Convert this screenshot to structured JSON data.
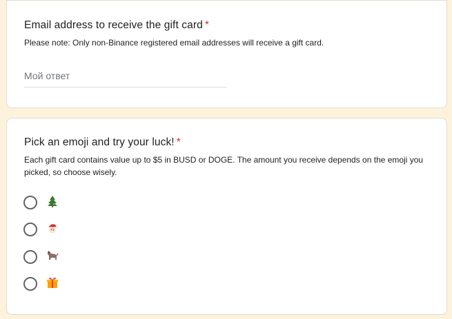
{
  "email_question": {
    "title": "Email address to receive the gift card",
    "required_mark": "*",
    "description": "Please note: Only non-Binance registered email addresses will receive a gift card.",
    "answer_placeholder": "Мой ответ"
  },
  "emoji_question": {
    "title": "Pick an emoji and try your luck!",
    "required_mark": "*",
    "description": "Each gift card contains value up to $5 in BUSD or DOGE. The amount you receive depends on the emoji you picked, so choose wisely.",
    "options": [
      {
        "icon": "christmas-tree-emoji",
        "selected": false
      },
      {
        "icon": "santa-claus-emoji",
        "selected": false
      },
      {
        "icon": "dog-emoji",
        "selected": false
      },
      {
        "icon": "wrapped-gift-emoji",
        "selected": false
      }
    ]
  },
  "colors": {
    "page_background": "#fdf3dd",
    "card_background": "#ffffff",
    "required_asterisk": "#d93025",
    "placeholder_text": "#70757a",
    "radio_border": "#5f6368"
  }
}
